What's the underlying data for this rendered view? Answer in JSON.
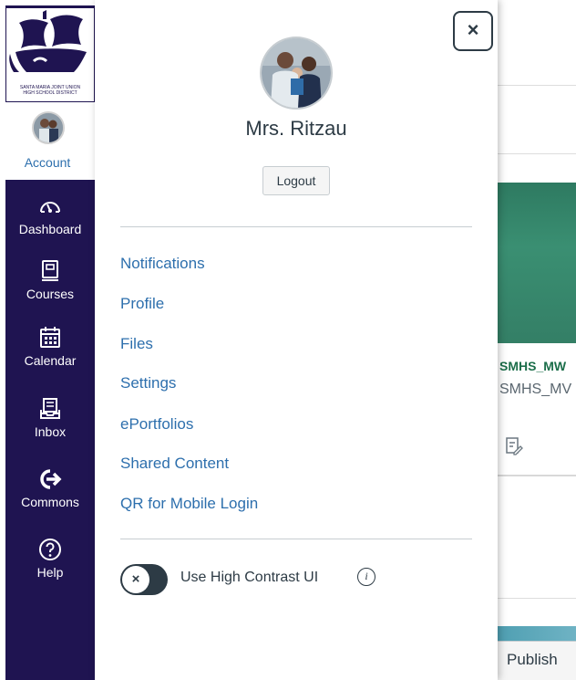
{
  "nav": {
    "logo": {
      "lines": [
        "SANTA MARIA JOINT UNION",
        "HIGH SCHOOL DISTRICT"
      ]
    },
    "account_label": "Account",
    "items": [
      {
        "label": "Dashboard",
        "icon": "dashboard-icon"
      },
      {
        "label": "Courses",
        "icon": "courses-icon"
      },
      {
        "label": "Calendar",
        "icon": "calendar-icon"
      },
      {
        "label": "Inbox",
        "icon": "inbox-icon"
      },
      {
        "label": "Commons",
        "icon": "commons-icon"
      },
      {
        "label": "Help",
        "icon": "help-icon"
      }
    ],
    "colors": {
      "background": "#1f1451",
      "account_text": "#2d6fad"
    }
  },
  "tray": {
    "close_label": "×",
    "user_name": "Mrs. Ritzau",
    "logout_label": "Logout",
    "links": [
      "Notifications",
      "Profile",
      "Files",
      "Settings",
      "ePortfolios",
      "Shared Content",
      "QR for Mobile Login"
    ],
    "high_contrast": {
      "label": "Use High Contrast UI",
      "enabled": false,
      "knob_symbol": "×",
      "info_symbol": "i"
    },
    "colors": {
      "link": "#2d6fad",
      "text": "#2d3b45"
    }
  },
  "background": {
    "course_title": "SMHS_MW",
    "course_subtitle": "SMHS_MV",
    "publish_label": "Publish"
  }
}
